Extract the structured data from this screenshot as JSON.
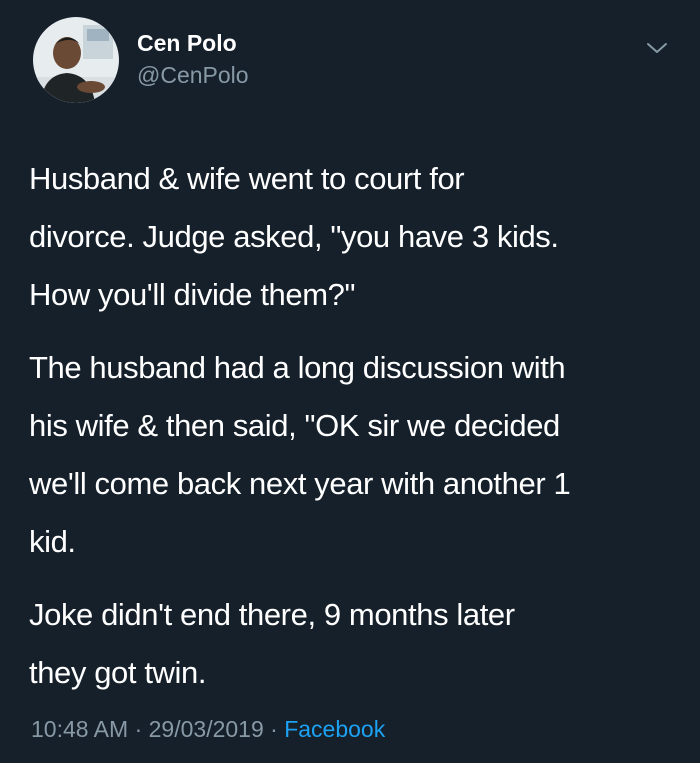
{
  "author": {
    "display_name": "Cen Polo",
    "handle": "@CenPolo"
  },
  "tweet": {
    "paragraphs": [
      "Husband & wife went to court for\ndivorce. Judge asked, \"you have 3 kids.\nHow you'll divide them?\"",
      "The husband had a long discussion with\nhis wife & then said, \"OK sir we decided\nwe'll come back next year with another 1\nkid.",
      "Joke didn't end there, 9 months later\nthey got twin."
    ]
  },
  "meta": {
    "time": "10:48 AM",
    "date": "29/03/2019",
    "separator": "·",
    "source": "Facebook"
  },
  "icons": {
    "more": "chevron-down-icon"
  },
  "colors": {
    "background": "#15202b",
    "text": "#ffffff",
    "muted": "#8899a6",
    "link": "#1da1f2"
  }
}
